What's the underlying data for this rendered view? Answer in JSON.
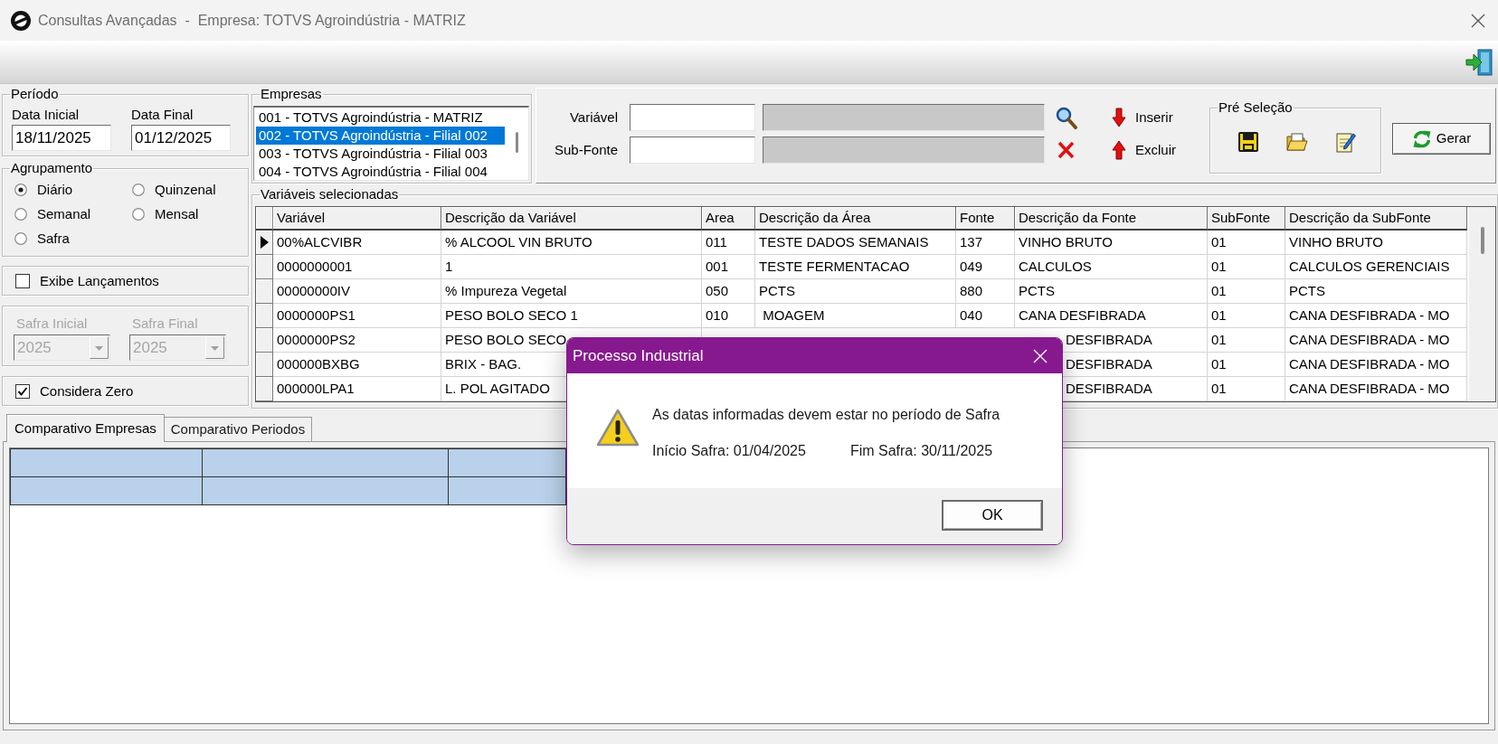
{
  "window": {
    "title": "Consultas Avançadas  -  Empresa: TOTVS Agroindústria - MATRIZ"
  },
  "periodo": {
    "title": "Período",
    "data_inicial": {
      "label": "Data Inicial",
      "value": "18/11/2025"
    },
    "data_final": {
      "label": "Data Final",
      "value": "01/12/2025"
    }
  },
  "agrupamento": {
    "title": "Agrupamento",
    "options": [
      {
        "label": "Diário",
        "selected": true
      },
      {
        "label": "Quinzenal",
        "selected": false
      },
      {
        "label": "Semanal",
        "selected": false
      },
      {
        "label": "Mensal",
        "selected": false
      },
      {
        "label": "Safra",
        "selected": false
      }
    ]
  },
  "exibe_lancamentos": {
    "label": "Exibe Lançamentos",
    "checked": false
  },
  "safra": {
    "disabled": true,
    "fields": [
      {
        "label": "Safra Inicial",
        "value": "2025"
      },
      {
        "label": "Safra Final",
        "value": "2025"
      }
    ]
  },
  "considera_zero": {
    "label": "Considera Zero",
    "checked": true
  },
  "empresas": {
    "title": "Empresas",
    "items": [
      {
        "label": "001 - TOTVS Agroindústria - MATRIZ",
        "selected": false
      },
      {
        "label": "002 - TOTVS Agroindústria - Filial 002",
        "selected": true
      },
      {
        "label": "003 - TOTVS Agroindústria - Filial 003",
        "selected": false
      },
      {
        "label": "004 - TOTVS Agroindústria - Filial 004",
        "selected": false
      }
    ]
  },
  "variavel_field": {
    "label": "Variável"
  },
  "sub_fonte_field": {
    "label": "Sub-Fonte"
  },
  "insert_button": "Inserir",
  "remove_button": "Excluir",
  "pre_selecao": {
    "title": "Pré Seleção"
  },
  "gerar_button": "Gerar",
  "variaveis_selecionadas": {
    "title": "Variáveis selecionadas",
    "columns": [
      "Variável",
      "Descrição da Variável",
      "Area",
      "Descrição da Área",
      "Fonte",
      "Descrição da Fonte",
      "SubFonte",
      "Descrição da SubFonte"
    ],
    "rows": [
      {
        "selected": true,
        "cells": [
          "00%ALCVIBR",
          "% ALCOOL VIN BRUTO",
          "011",
          "TESTE DADOS SEMANAIS",
          "137",
          "VINHO BRUTO",
          "01",
          "VINHO BRUTO"
        ]
      },
      {
        "selected": false,
        "cells": [
          "0000000001",
          "1",
          "001",
          "TESTE FERMENTACAO",
          "049",
          "CALCULOS",
          "01",
          "CALCULOS GERENCIAIS"
        ]
      },
      {
        "selected": false,
        "cells": [
          "00000000IV",
          "% Impureza Vegetal",
          "050",
          "PCTS",
          "880",
          "PCTS",
          "01",
          "PCTS"
        ]
      },
      {
        "selected": false,
        "cells": [
          "0000000PS1",
          "PESO BOLO SECO 1",
          "010",
          " MOAGEM",
          "040",
          "CANA DESFIBRADA",
          "01",
          "CANA DESFIBRADA - MO"
        ]
      },
      {
        "selected": false,
        "cells": [
          "0000000PS2",
          "PESO BOLO SECO"
        ],
        "cells_right_of_dialog": [
          "DESFIBRADA",
          "01",
          "CANA DESFIBRADA - MO"
        ]
      },
      {
        "selected": false,
        "cells": [
          "000000BXBG",
          "BRIX - BAG."
        ],
        "cells_right_of_dialog": [
          "DESFIBRADA",
          "01",
          "CANA DESFIBRADA - MO"
        ]
      },
      {
        "selected": false,
        "cells": [
          "000000LPA1",
          "L. POL AGITADO"
        ],
        "cells_right_of_dialog": [
          "DESFIBRADA",
          "01",
          "CANA DESFIBRADA - MO"
        ]
      }
    ]
  },
  "bottom_tabs": [
    {
      "label": "Comparativo Empresas",
      "selected": true
    },
    {
      "label": "Comparativo Periodos",
      "selected": false
    }
  ],
  "dialog": {
    "title": "Processo Industrial",
    "message": "As datas informadas devem estar no período de Safra",
    "inicio_safra": "Início Safra: 01/04/2025",
    "fim_safra": "Fim Safra: 30/11/2025",
    "button": "OK"
  }
}
